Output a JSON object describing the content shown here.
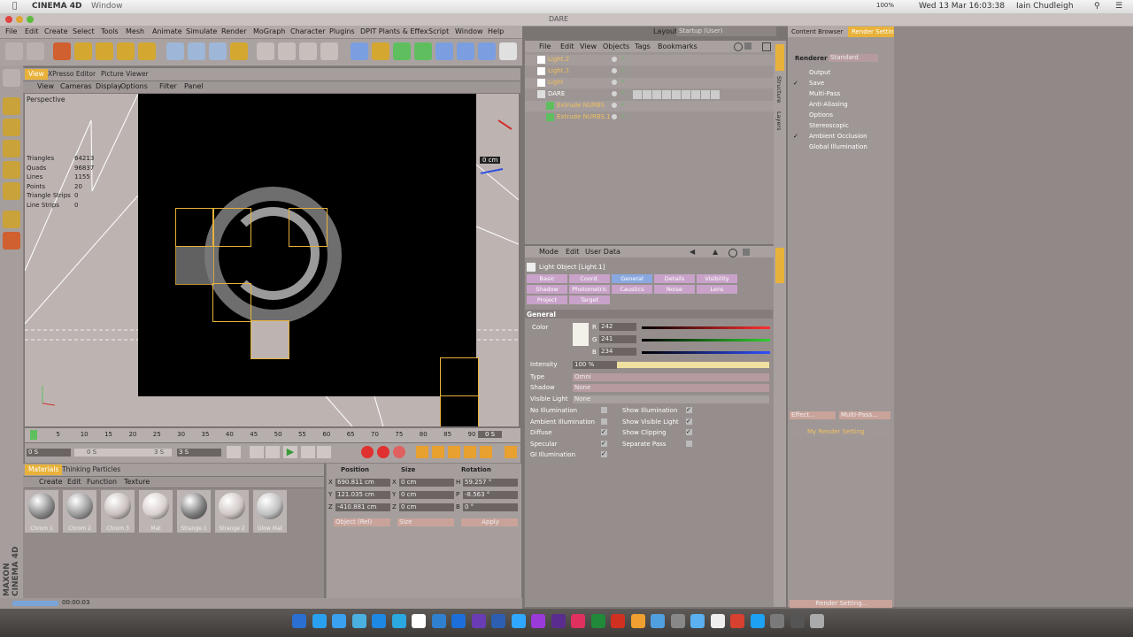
{
  "macbar": {
    "app": "CINEMA 4D",
    "menu": "Window",
    "clock": "Wed 13 Mar 16:03:38",
    "user": "Iain Chudleigh",
    "battery": "100%"
  },
  "doc_title": "DARE",
  "layout": {
    "label": "Layout:",
    "value": "Startup (User)"
  },
  "menu": [
    "File",
    "Edit",
    "Create",
    "Select",
    "Tools",
    "Mesh",
    "Animate",
    "Simulate",
    "Render",
    "MoGraph",
    "Character",
    "Plugins",
    "DPIT Plants & Effex",
    "Script",
    "Window",
    "Help"
  ],
  "viewport_tabs": [
    "View",
    "XPresso Editor",
    "Picture Viewer"
  ],
  "viewport_menu": [
    "View",
    "Cameras",
    "Display",
    "Options",
    "Filter",
    "Panel"
  ],
  "viewport": {
    "label": "Perspective",
    "stats": [
      {
        "k": "Triangles",
        "v": "64213"
      },
      {
        "k": "Quads",
        "v": "96837"
      },
      {
        "k": "Lines",
        "v": "1155"
      },
      {
        "k": "Points",
        "v": "20"
      },
      {
        "k": "Triangle Strips",
        "v": "0"
      },
      {
        "k": "Line Strips",
        "v": "0"
      }
    ],
    "measure": "0 cm"
  },
  "timeline": {
    "ticks": [
      "0",
      "5",
      "10",
      "15",
      "20",
      "25",
      "30",
      "35",
      "40",
      "45",
      "50",
      "55",
      "60",
      "65",
      "70",
      "75",
      "80",
      "85",
      "90"
    ],
    "end": "0 S",
    "playhead_fraction": 0.0
  },
  "transport": {
    "start": "0 S",
    "min": "0 S",
    "max": "3 S",
    "end": "3 S"
  },
  "material_tabs": [
    "Materials",
    "Thinking Particles"
  ],
  "material_menu": [
    "Create",
    "Edit",
    "Function",
    "Texture"
  ],
  "materials": [
    {
      "name": "Chrom 1",
      "color": "#8a8a8a"
    },
    {
      "name": "Chrom 2",
      "color": "#9a9a9a"
    },
    {
      "name": "Chrom 3",
      "color": "#c9c0be"
    },
    {
      "name": "Mat",
      "color": "#d8cfcd"
    },
    {
      "name": "Strange 1",
      "color": "#7d7d7d"
    },
    {
      "name": "Strange 2",
      "color": "#cfc6c4"
    },
    {
      "name": "Glow Mat",
      "color": "#c0c0c0"
    }
  ],
  "coords": {
    "headers": [
      "Position",
      "Size",
      "Rotation"
    ],
    "rows": [
      {
        "axis": "X",
        "pos": "690.811 cm",
        "size": "0 cm",
        "rlabel": "H",
        "rot": "59.257 °"
      },
      {
        "axis": "Y",
        "pos": "121.035 cm",
        "size": "0 cm",
        "rlabel": "P",
        "rot": "-8.563 °"
      },
      {
        "axis": "Z",
        "pos": "-410.881 cm",
        "size": "0 cm",
        "rlabel": "B",
        "rot": "0 °"
      }
    ],
    "mode": "Object (Rel)",
    "size_mode": "Size",
    "apply": "Apply"
  },
  "status_time": "00:00:03",
  "objmgr_menu": [
    "File",
    "Edit",
    "View",
    "Objects",
    "Tags",
    "Bookmarks"
  ],
  "objects": [
    {
      "name": "Light.2",
      "indent": 0
    },
    {
      "name": "Light.1",
      "indent": 0
    },
    {
      "name": "Light",
      "indent": 0
    },
    {
      "name": "DARE",
      "indent": 0
    },
    {
      "name": "Extrude NURBS",
      "indent": 1
    },
    {
      "name": "Extrude NURBS.1",
      "indent": 1
    }
  ],
  "attr_menu": [
    "Mode",
    "Edit",
    "User Data"
  ],
  "attr_title": "Light Object [Light.1]",
  "attr_tabs": [
    "Basic",
    "Coord.",
    "General",
    "Details",
    "Visibility",
    "Shadow",
    "Photometric",
    "Caustics",
    "Noise",
    "Lens",
    "Project",
    "Target"
  ],
  "attr_section": "General",
  "color": {
    "label": "Color",
    "r": "242",
    "g": "241",
    "b": "234"
  },
  "intensity": {
    "label": "Intensity",
    "value": "100 %"
  },
  "type": {
    "label": "Type",
    "value": "Omni"
  },
  "shadow": {
    "label": "Shadow",
    "value": "None"
  },
  "visible_light": {
    "label": "Visible Light",
    "value": "None"
  },
  "checks_left": [
    {
      "label": "No Illumination",
      "checked": false
    },
    {
      "label": "Ambient Illumination",
      "checked": false
    },
    {
      "label": "Diffuse",
      "checked": true
    },
    {
      "label": "Specular",
      "checked": true
    },
    {
      "label": "GI Illumination",
      "checked": true
    }
  ],
  "checks_right": [
    {
      "label": "Show Illumination",
      "checked": true
    },
    {
      "label": "Show Visible Light",
      "checked": true
    },
    {
      "label": "Show Clipping",
      "checked": true
    },
    {
      "label": "Separate Pass",
      "checked": false
    }
  ],
  "side_tabs": [
    "Objects",
    "Structure",
    "Layers"
  ],
  "content_tabs": [
    "Content Browser",
    "Render Settings"
  ],
  "render_settings": {
    "renderer_label": "Renderer",
    "renderer_value": "Standard",
    "items": [
      {
        "label": "Output",
        "checked": false
      },
      {
        "label": "Save",
        "checked": true
      },
      {
        "label": "Multi-Pass",
        "checked": false
      },
      {
        "label": "Anti-Aliasing",
        "checked": false
      },
      {
        "label": "Options",
        "checked": false
      },
      {
        "label": "Stereoscopic",
        "checked": false
      },
      {
        "label": "Ambient Occlusion",
        "checked": true
      },
      {
        "label": "Global Illumination",
        "checked": false
      }
    ],
    "effect_btn": "Effect...",
    "multipass_btn": "Multi-Pass...",
    "my_setting": "My Render Setting",
    "bottom_btn": "Render Setting..."
  },
  "colors": {
    "accent": "#e8b23a",
    "highlight": "#7a9ee0"
  }
}
